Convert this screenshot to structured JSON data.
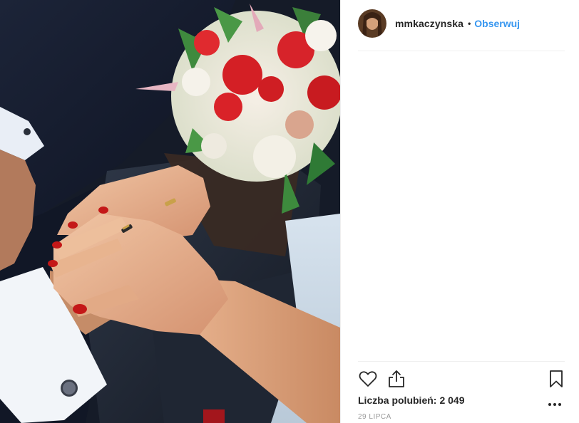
{
  "post": {
    "image_alt": "Photo of hands with wedding rings and a bouquet of flowers",
    "author": {
      "username": "mmkaczynska",
      "follow_label": "Obserwuj",
      "separator": "•"
    },
    "actions": {
      "like_icon": "heart-icon",
      "share_icon": "share-icon",
      "save_icon": "bookmark-icon",
      "more_icon": "more-options-icon"
    },
    "likes": {
      "label": "Liczba polubień:",
      "count": "2 049"
    },
    "date": "29 LIPCA"
  },
  "colors": {
    "accent": "#3897f0",
    "text": "#262626",
    "muted": "#999999",
    "divider": "#efefef"
  }
}
